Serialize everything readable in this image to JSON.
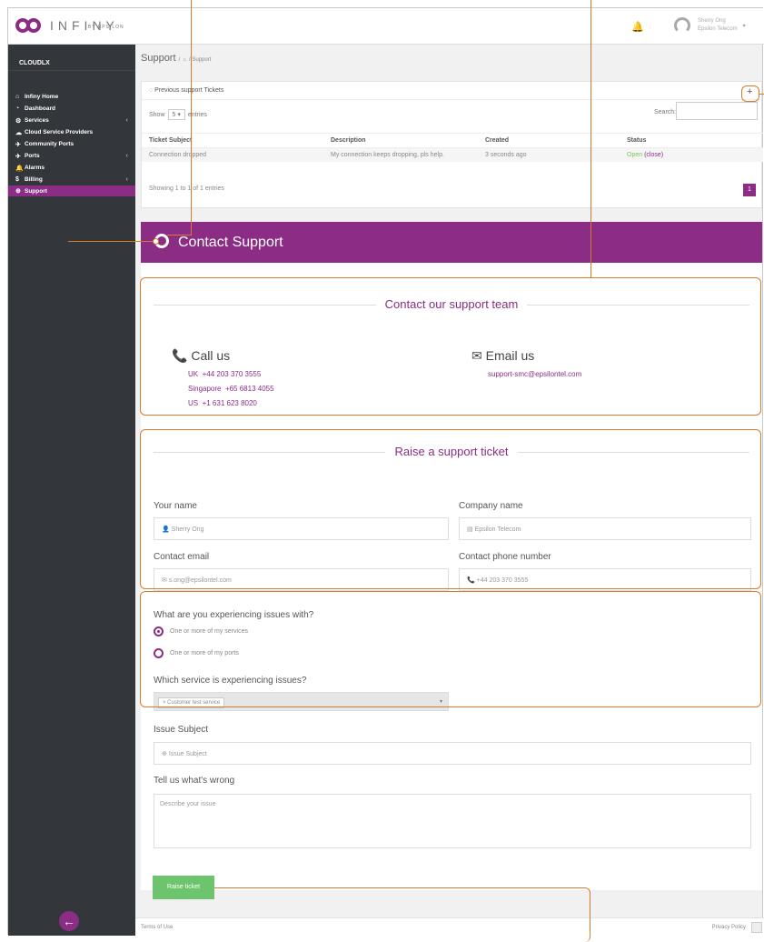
{
  "app": {
    "logo_text": "INFINY",
    "logo_sub": "BY EPSILON",
    "user_name": "Sherry Ong",
    "user_org": "Epsilon Telecom"
  },
  "sidebar": {
    "org": "CLOUDLX",
    "items": [
      {
        "label": "Infiny Home",
        "icon": "home-icon",
        "arrow": ""
      },
      {
        "label": "Dashboard",
        "icon": "dashboard-icon",
        "arrow": ""
      },
      {
        "label": "Services",
        "icon": "services-icon",
        "arrow": "‹"
      },
      {
        "label": "Cloud Service Providers",
        "icon": "cloud-icon",
        "arrow": ""
      },
      {
        "label": "Community Ports",
        "icon": "ports-icon",
        "arrow": ""
      },
      {
        "label": "Ports",
        "icon": "ports-icon",
        "arrow": "‹"
      },
      {
        "label": "Alarms",
        "icon": "bell-icon",
        "arrow": ""
      },
      {
        "label": "Billing",
        "icon": "dollar-icon",
        "arrow": "‹"
      },
      {
        "label": "Support",
        "icon": "support-icon",
        "arrow": "",
        "active": true
      }
    ]
  },
  "breadcrumb": {
    "title": "Support",
    "separator": "/",
    "home": "⌂",
    "current": "/ Support"
  },
  "tickets": {
    "panel_title": "Previous support Tickets",
    "show_label": "Show",
    "entries_value": "5",
    "entries_label": "entries",
    "search_label": "Search:",
    "headers": [
      "Ticket Subject",
      "Description",
      "Created",
      "Status"
    ],
    "rows": [
      {
        "subject": "Connection dropped",
        "description": "My connection keeps dropping, pls help.",
        "created": "3 seconds ago",
        "status": "Open",
        "close": "(close)"
      }
    ],
    "info": "Showing 1 to 1 of 1 entries",
    "page": "1"
  },
  "contact": {
    "header": "Contact Support",
    "section_title": "Contact our support team",
    "call_title": "Call us",
    "phones": [
      {
        "country": "UK",
        "number": "+44 203 370 3555"
      },
      {
        "country": "Singapore",
        "number": "+65 6813 4055"
      },
      {
        "country": "US",
        "number": "+1 631 623 8020"
      }
    ],
    "email_title": "Email us",
    "email": "support-smc@epsilontel.com"
  },
  "form": {
    "section_title": "Raise a support ticket",
    "your_name_label": "Your name",
    "your_name_value": "Sherry Ong",
    "company_label": "Company name",
    "company_value": "Epsilon Telecom",
    "email_label": "Contact email",
    "email_value": "s.ong@epsilontel.com",
    "phone_label": "Contact phone number",
    "phone_value": "+44 203 370 3555",
    "issue_question": "What are you experiencing issues with?",
    "radio_services": "One or more of my services",
    "radio_ports": "One or more of my ports",
    "service_question": "Which service is experiencing issues?",
    "service_selected": "× Customer test service",
    "subject_label": "Issue Subject",
    "subject_placeholder": "Issue Subject",
    "wrong_label": "Tell us what's wrong",
    "wrong_placeholder": "Describe your issue",
    "submit": "Raise ticket"
  },
  "footer": {
    "terms": "Terms of Use",
    "privacy": "Privacy Policy"
  },
  "colors": {
    "brand": "#8b2d84",
    "sidebar": "#33363b",
    "success": "#6cc46c",
    "callout": "#d77a2c"
  }
}
